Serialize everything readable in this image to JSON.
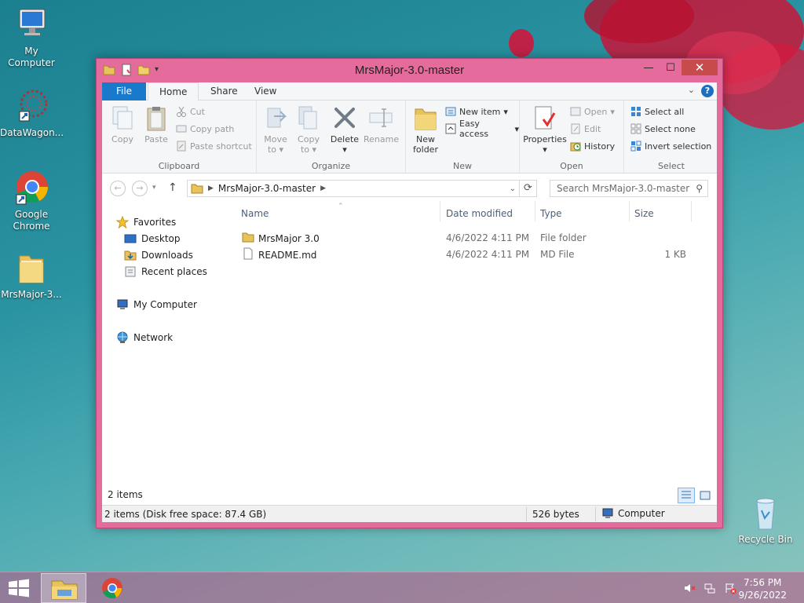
{
  "desktop": {
    "icons": [
      {
        "label": "My Computer"
      },
      {
        "label": "DataWagon..."
      },
      {
        "label": "Google Chrome"
      },
      {
        "label": "MrsMajor-3..."
      },
      {
        "label": "Recycle Bin"
      }
    ]
  },
  "window": {
    "title": "MrsMajor-3.0-master",
    "accent_color": "#e46b9b",
    "controls": {
      "minimize": "—",
      "maximize": "☐",
      "close": "✕"
    }
  },
  "ribbon": {
    "tabs": {
      "file": "File",
      "home": "Home",
      "share": "Share",
      "view": "View"
    },
    "help": "?",
    "clipboard": {
      "label": "Clipboard",
      "copy": "Copy",
      "paste": "Paste",
      "cut": "Cut",
      "copy_path": "Copy path",
      "paste_shortcut": "Paste shortcut"
    },
    "organize": {
      "label": "Organize",
      "move_to_1": "Move",
      "move_to_2": "to",
      "copy_to_1": "Copy",
      "copy_to_2": "to",
      "delete": "Delete",
      "rename": "Rename"
    },
    "new": {
      "label": "New",
      "new_folder_1": "New",
      "new_folder_2": "folder",
      "new_item": "New item",
      "easy_access": "Easy access"
    },
    "open": {
      "label": "Open",
      "properties": "Properties",
      "open": "Open",
      "edit": "Edit",
      "history": "History"
    },
    "select": {
      "label": "Select",
      "select_all": "Select all",
      "select_none": "Select none",
      "invert_selection": "Invert selection"
    }
  },
  "address": {
    "path": "MrsMajor-3.0-master",
    "search_placeholder": "Search MrsMajor-3.0-master"
  },
  "nav": {
    "favorites": "Favorites",
    "desktop": "Desktop",
    "downloads": "Downloads",
    "recent": "Recent places",
    "computer": "My Computer",
    "network": "Network"
  },
  "files": {
    "columns": {
      "name": "Name",
      "date": "Date modified",
      "type": "Type",
      "size": "Size"
    },
    "rows": [
      {
        "name": "MrsMajor 3.0",
        "date": "4/6/2022 4:11 PM",
        "type": "File folder",
        "size": ""
      },
      {
        "name": "README.md",
        "date": "4/6/2022 4:11 PM",
        "type": "MD File",
        "size": "1 KB"
      }
    ]
  },
  "status": {
    "items": "2 items",
    "disk": "2 items (Disk free space: 87.4 GB)",
    "bytes": "526 bytes",
    "location": "Computer"
  },
  "taskbar": {
    "time": "7:56 PM",
    "date": "9/26/2022"
  }
}
